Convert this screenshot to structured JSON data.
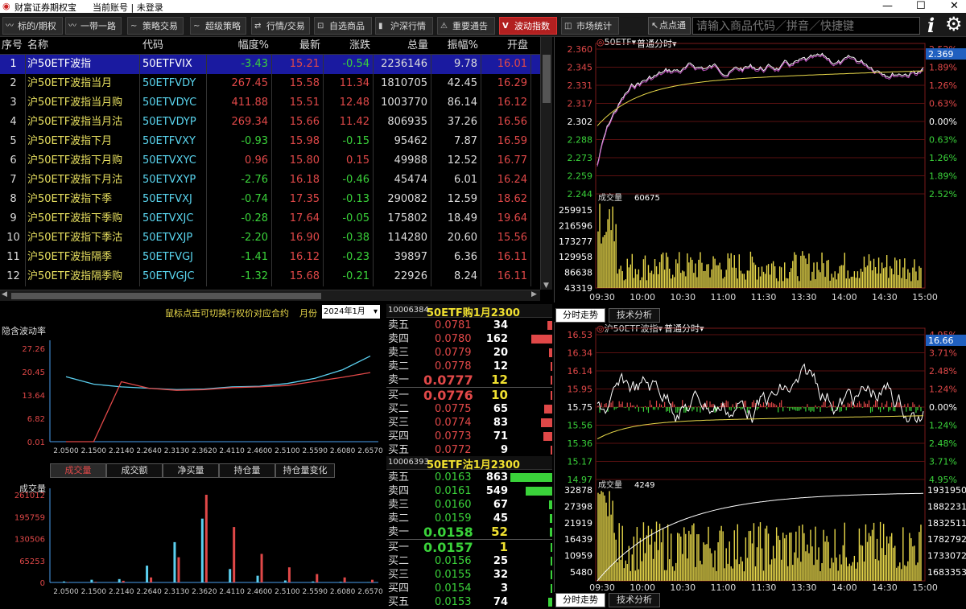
{
  "window": {
    "app_title": "财富证券期权宝",
    "account": "当前账号 | 未登录"
  },
  "toolbar": {
    "items": [
      {
        "label": "标的/期权",
        "icon": "chart-line-icon"
      },
      {
        "label": "一带一路",
        "icon": "chart-line-icon"
      },
      {
        "label": "策略交易",
        "icon": "strategy-icon"
      },
      {
        "label": "超级策略",
        "icon": "strategy-icon"
      },
      {
        "label": "行情/交易",
        "icon": "quote-icon"
      },
      {
        "label": "自选商品",
        "icon": "cart-icon"
      },
      {
        "label": "沪深行情",
        "icon": "bars-icon"
      },
      {
        "label": "重要通告",
        "icon": "warning-icon"
      },
      {
        "label": "波动指数",
        "icon": "volatility-icon"
      },
      {
        "label": "市场统计",
        "icon": "stats-icon"
      }
    ],
    "diandian_label": "点点通",
    "search_placeholder": "请输入商品代码／拼音／快捷键"
  },
  "table": {
    "headers": [
      "序号",
      "名称",
      "代码",
      "幅度%",
      "最新",
      "涨跌",
      "总量",
      "振幅%",
      "开盘"
    ],
    "rows": [
      {
        "idx": "1",
        "name": "沪50ETF波指",
        "code": "50ETFVIX",
        "pct": "-3.43",
        "last": "15.21",
        "chg": "-0.54",
        "vol": "2236146",
        "amp": "9.78",
        "open": "16.01"
      },
      {
        "idx": "2",
        "name": "沪50ETF波指当月",
        "code": "50ETFVDY",
        "pct": "267.45",
        "last": "15.58",
        "chg": "11.34",
        "vol": "1810705",
        "amp": "42.45",
        "open": "16.29"
      },
      {
        "idx": "3",
        "name": "沪50ETF波指当月购",
        "code": "50ETVDYC",
        "pct": "411.88",
        "last": "15.51",
        "chg": "12.48",
        "vol": "1003770",
        "amp": "86.14",
        "open": "16.12"
      },
      {
        "idx": "4",
        "name": "沪50ETF波指当月沽",
        "code": "50ETVDYP",
        "pct": "269.34",
        "last": "15.66",
        "chg": "11.42",
        "vol": "806935",
        "amp": "37.26",
        "open": "16.56"
      },
      {
        "idx": "5",
        "name": "沪50ETF波指下月",
        "code": "50ETFVXY",
        "pct": "-0.93",
        "last": "15.98",
        "chg": "-0.15",
        "vol": "95462",
        "amp": "7.87",
        "open": "16.59"
      },
      {
        "idx": "6",
        "name": "沪50ETF波指下月购",
        "code": "50ETVXYC",
        "pct": "0.96",
        "last": "15.80",
        "chg": "0.15",
        "vol": "49988",
        "amp": "12.52",
        "open": "16.77"
      },
      {
        "idx": "7",
        "name": "沪50ETF波指下月沽",
        "code": "50ETVXYP",
        "pct": "-2.76",
        "last": "16.18",
        "chg": "-0.46",
        "vol": "45474",
        "amp": "6.01",
        "open": "16.24"
      },
      {
        "idx": "8",
        "name": "沪50ETF波指下季",
        "code": "50ETFVXJ",
        "pct": "-0.74",
        "last": "17.35",
        "chg": "-0.13",
        "vol": "290082",
        "amp": "12.59",
        "open": "18.62"
      },
      {
        "idx": "9",
        "name": "沪50ETF波指下季购",
        "code": "50ETVXJC",
        "pct": "-0.28",
        "last": "17.64",
        "chg": "-0.05",
        "vol": "175802",
        "amp": "18.49",
        "open": "19.64"
      },
      {
        "idx": "10",
        "name": "沪50ETF波指下季沽",
        "code": "50ETVXJP",
        "pct": "-2.20",
        "last": "16.90",
        "chg": "-0.38",
        "vol": "114280",
        "amp": "20.60",
        "open": "15.56"
      },
      {
        "idx": "11",
        "name": "沪50ETF波指隔季",
        "code": "50ETFVGJ",
        "pct": "-1.41",
        "last": "16.12",
        "chg": "-0.23",
        "vol": "39897",
        "amp": "6.36",
        "open": "16.11"
      },
      {
        "idx": "12",
        "name": "沪50ETF波指隔季购",
        "code": "50ETVGJC",
        "pct": "-1.32",
        "last": "15.68",
        "chg": "-0.21",
        "vol": "22926",
        "amp": "8.24",
        "open": "16.11"
      }
    ]
  },
  "ivpanel": {
    "hint": "鼠标点击可切换行权价对应合约",
    "month_label": "月份",
    "month_value": "2024年1月",
    "iv_title": "隐含波动率",
    "vol_title": "成交量",
    "tabs": [
      "成交量",
      "成交额",
      "净买量",
      "持仓量",
      "持仓量变化"
    ]
  },
  "orderbook1": {
    "code": "10006384",
    "name": "50ETF购1月2300",
    "asks": [
      {
        "label": "卖五",
        "price": "0.0781",
        "qty": "34",
        "bar": 0.11
      },
      {
        "label": "卖四",
        "price": "0.0780",
        "qty": "162",
        "bar": 0.5
      },
      {
        "label": "卖三",
        "price": "0.0779",
        "qty": "20",
        "bar": 0.07
      },
      {
        "label": "卖二",
        "price": "0.0778",
        "qty": "12",
        "bar": 0.04
      },
      {
        "label": "卖一",
        "price": "0.0777",
        "qty": "12",
        "bar": 0.04
      }
    ],
    "bids": [
      {
        "label": "买一",
        "price": "0.0776",
        "qty": "10",
        "bar": 0.03
      },
      {
        "label": "买二",
        "price": "0.0775",
        "qty": "65",
        "bar": 0.2
      },
      {
        "label": "买三",
        "price": "0.0774",
        "qty": "83",
        "bar": 0.26
      },
      {
        "label": "买四",
        "price": "0.0773",
        "qty": "71",
        "bar": 0.22
      },
      {
        "label": "买五",
        "price": "0.0772",
        "qty": "9",
        "bar": 0.03
      }
    ]
  },
  "orderbook2": {
    "code": "10006393",
    "name": "50ETF沽1月2300",
    "asks": [
      {
        "label": "卖五",
        "price": "0.0163",
        "qty": "863",
        "bar": 1.0
      },
      {
        "label": "卖四",
        "price": "0.0161",
        "qty": "549",
        "bar": 0.64
      },
      {
        "label": "卖三",
        "price": "0.0160",
        "qty": "67",
        "bar": 0.08
      },
      {
        "label": "卖二",
        "price": "0.0159",
        "qty": "45",
        "bar": 0.05
      },
      {
        "label": "卖一",
        "price": "0.0158",
        "qty": "52",
        "bar": 0.06
      }
    ],
    "bids": [
      {
        "label": "买一",
        "price": "0.0157",
        "qty": "1",
        "bar": 0.01
      },
      {
        "label": "买二",
        "price": "0.0156",
        "qty": "25",
        "bar": 0.03
      },
      {
        "label": "买三",
        "price": "0.0155",
        "qty": "32",
        "bar": 0.04
      },
      {
        "label": "买四",
        "price": "0.0154",
        "qty": "3",
        "bar": 0.01
      },
      {
        "label": "买五",
        "price": "0.0153",
        "qty": "74",
        "bar": 0.09
      }
    ]
  },
  "chart1": {
    "symbol": "50ETF",
    "mode": "普通分时",
    "last_tag": "2.369",
    "price_ticks": [
      "2.360",
      "2.345",
      "2.331",
      "2.317",
      "2.302",
      "2.288",
      "2.273",
      "2.259",
      "2.244"
    ],
    "pct_ticks": [
      "2.52%",
      "1.89%",
      "1.26%",
      "0.63%",
      "0.00%",
      "0.63%",
      "1.26%",
      "1.89%",
      "2.52%"
    ],
    "vol_label": "成交量",
    "vol_value": "60675",
    "vol_ticks": [
      "259915",
      "216596",
      "173277",
      "129958",
      "86638",
      "43319"
    ],
    "time_ticks": [
      "09:30",
      "10:00",
      "10:30",
      "11:00",
      "11:30",
      "13:30",
      "14:00",
      "14:30",
      "15:00"
    ]
  },
  "chart2": {
    "symbol": "沪50ETF波指",
    "mode": "普通分时",
    "last_tag": "16.66",
    "price_ticks": [
      "16.53",
      "16.34",
      "16.14",
      "15.95",
      "15.75",
      "15.56",
      "15.36",
      "15.17",
      "14.97"
    ],
    "pct_ticks": [
      "4.95%",
      "3.71%",
      "2.48%",
      "1.24%",
      "0.00%",
      "1.24%",
      "2.48%",
      "3.71%",
      "4.95%"
    ],
    "vol_label": "成交量",
    "vol_value": "4249",
    "vol_ticks_left": [
      "32878",
      "27398",
      "21919",
      "16439",
      "10959",
      "5480"
    ],
    "vol_ticks_right": [
      "1931950",
      "1882231",
      "1832511",
      "1782792",
      "1733072",
      "1683353"
    ],
    "time_ticks": [
      "09:30",
      "10:00",
      "10:30",
      "11:00",
      "11:30",
      "13:30",
      "14:00",
      "14:30",
      "15:00"
    ]
  },
  "right_tabs": [
    "分时走势",
    "技术分析"
  ],
  "chart_data": [
    {
      "type": "line",
      "title": "隐含波动率",
      "categories": [
        "2.0500",
        "2.1500",
        "2.2140",
        "2.2640",
        "2.3130",
        "2.3620",
        "2.4110",
        "2.4600",
        "2.5100",
        "2.5590",
        "2.6080",
        "2.6570"
      ],
      "ylim": [
        0.01,
        27.26
      ],
      "yticks": [
        "27.26",
        "20.45",
        "13.64",
        "6.82",
        "0.01"
      ],
      "series": [
        {
          "name": "",
          "color": "#5bd0f0",
          "values": [
            19.0,
            16.8,
            16.0,
            15.6,
            15.2,
            15.4,
            16.0,
            16.2,
            17.0,
            18.5,
            21.0,
            25.0
          ]
        },
        {
          "name": "",
          "color": "#e04848",
          "values": [
            0.01,
            0.01,
            17.5,
            15.6,
            15.0,
            15.2,
            15.8,
            16.0,
            16.4,
            17.6,
            18.8,
            20.2
          ]
        }
      ]
    },
    {
      "type": "bar",
      "title": "成交量",
      "categories": [
        "2.0500",
        "2.1500",
        "2.2140",
        "2.2640",
        "2.3130",
        "2.3620",
        "2.4110",
        "2.4600",
        "2.5100",
        "2.5590",
        "2.6080",
        "2.6570"
      ],
      "ylim": [
        0,
        261012
      ],
      "yticks": [
        "261012",
        "195759",
        "130506",
        "65253",
        "0"
      ],
      "series": [
        {
          "name": "",
          "color": "#5bd0f0",
          "values": [
            3000,
            8000,
            10000,
            50000,
            120000,
            190000,
            40000,
            20000,
            6000,
            3000,
            2000,
            1000
          ]
        },
        {
          "name": "",
          "color": "#e04848",
          "values": [
            1000,
            2000,
            5000,
            15000,
            75000,
            261012,
            165000,
            85000,
            45000,
            25000,
            15000,
            8000
          ]
        }
      ]
    }
  ]
}
